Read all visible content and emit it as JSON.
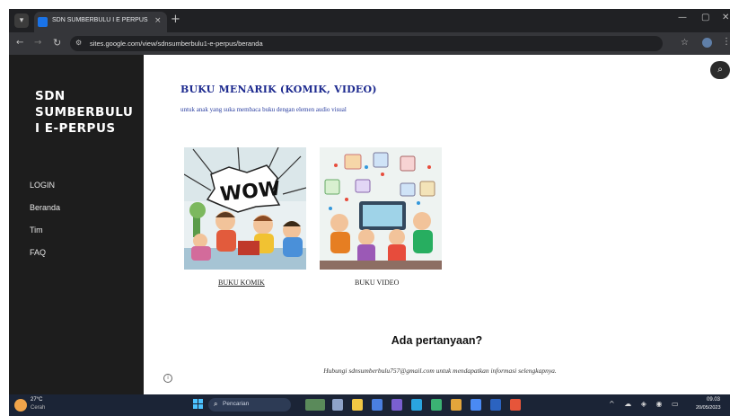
{
  "browser": {
    "tab_title": "SDN SUMBERBULU I E PERPUS",
    "tab_close": "×",
    "new_tab": "+",
    "url": "sites.google.com/view/sdnsumberbulu1-e-perpus/beranda",
    "window_controls": {
      "minimize": "—",
      "maximize": "▢",
      "close": "✕"
    }
  },
  "sidebar": {
    "site_title": "SDN SUMBERBULU I E-PERPUS",
    "nav_items": [
      {
        "label": "LOGIN"
      },
      {
        "label": "Beranda"
      },
      {
        "label": "Tim"
      },
      {
        "label": "FAQ"
      }
    ]
  },
  "main": {
    "heading": "BUKU MENARIK (KOMIK, VIDEO)",
    "subheading": "untuk anak yang suka membaca buku dengan elemen audio visual",
    "cards": [
      {
        "caption": "BUKU KOMIK",
        "image_word": "WOW",
        "icon": "comic-illustration"
      },
      {
        "caption": "BUKU VIDEO",
        "icon": "video-call-illustration"
      }
    ],
    "faq_heading": "Ada pertanyaan?",
    "faq_body": "Hubungi sdnsumberbulu757@gmail.com untuk mendapatkan informasi selengkapnya.",
    "info_icon": "i"
  },
  "taskbar": {
    "weather_temp": "27°C",
    "weather_desc": "Cerah",
    "search_placeholder": "Pencarian",
    "clock_time": "09.03",
    "clock_date": "20/05/2023",
    "colors": {
      "bar": "#1b2436",
      "accent": "#4cc2ff"
    }
  },
  "colors": {
    "sidebar_bg": "#1d1d1d",
    "heading_blue": "#1d2a8f",
    "page_bg": "#ffffff"
  }
}
